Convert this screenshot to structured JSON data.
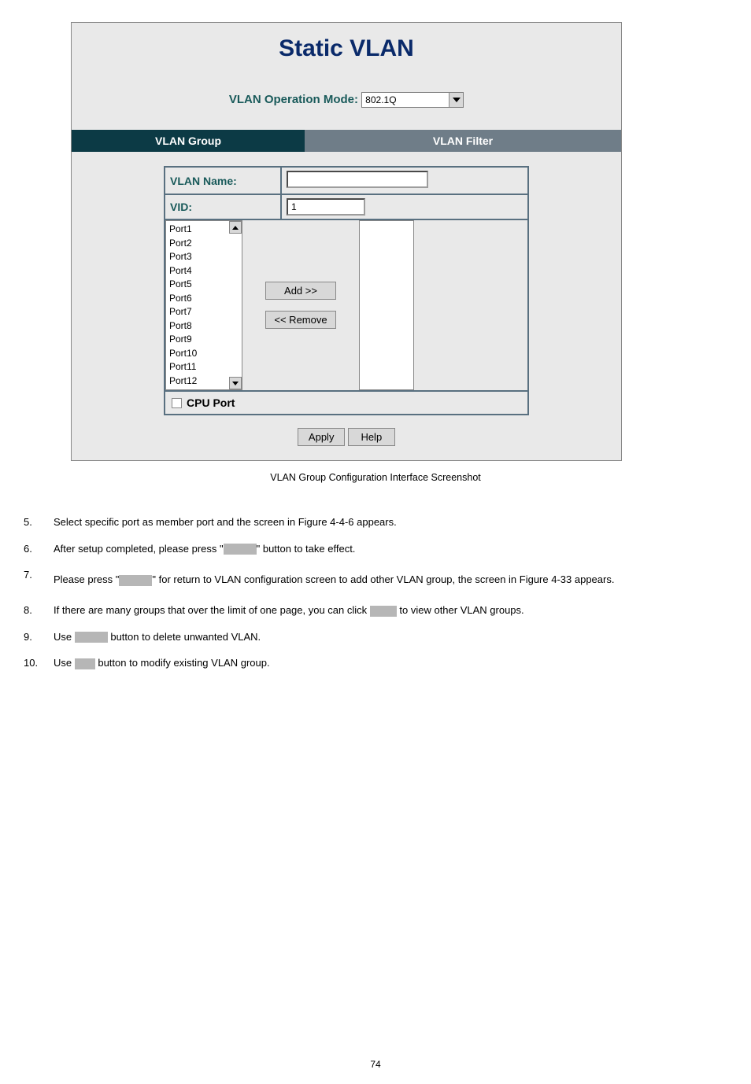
{
  "screenshot": {
    "title": "Static VLAN",
    "opModeLabel": "VLAN Operation Mode:",
    "opModeValue": "802.1Q",
    "tabLeft": "VLAN Group",
    "tabRight": "VLAN Filter",
    "vlanNameLabel": "VLAN Name:",
    "vlanNameValue": "",
    "vidLabel": "VID:",
    "vidValue": "1",
    "ports": [
      "Port1",
      "Port2",
      "Port3",
      "Port4",
      "Port5",
      "Port6",
      "Port7",
      "Port8",
      "Port9",
      "Port10",
      "Port11",
      "Port12"
    ],
    "addBtn": "Add  >>",
    "removeBtn": "<<  Remove",
    "cpuPort": "CPU Port",
    "applyBtn": "Apply",
    "helpBtn": "Help"
  },
  "caption": "VLAN Group Configuration Interface Screenshot",
  "instr": {
    "n5": "5.",
    "t5": "Select specific port as member port and the screen in Figure 4-4-6 appears.",
    "n6": "6.",
    "t6a": "After setup completed, please press \"",
    "t6b": "\" button to take effect.",
    "n7": "7.",
    "t7a": "Please press \"",
    "t7b": "\" for return to VLAN configuration screen to add other VLAN group, the screen in Figure 4-33 appears.",
    "n8": "8.",
    "t8a": "If there are many groups that over the limit of one page, you can click ",
    "t8b": " to view other VLAN groups.",
    "n9": "9.",
    "t9a": "Use ",
    "t9b": " button to delete unwanted VLAN.",
    "n10": "10.",
    "t10a": "Use ",
    "t10b": " button to modify existing VLAN group."
  },
  "pageNum": "74"
}
